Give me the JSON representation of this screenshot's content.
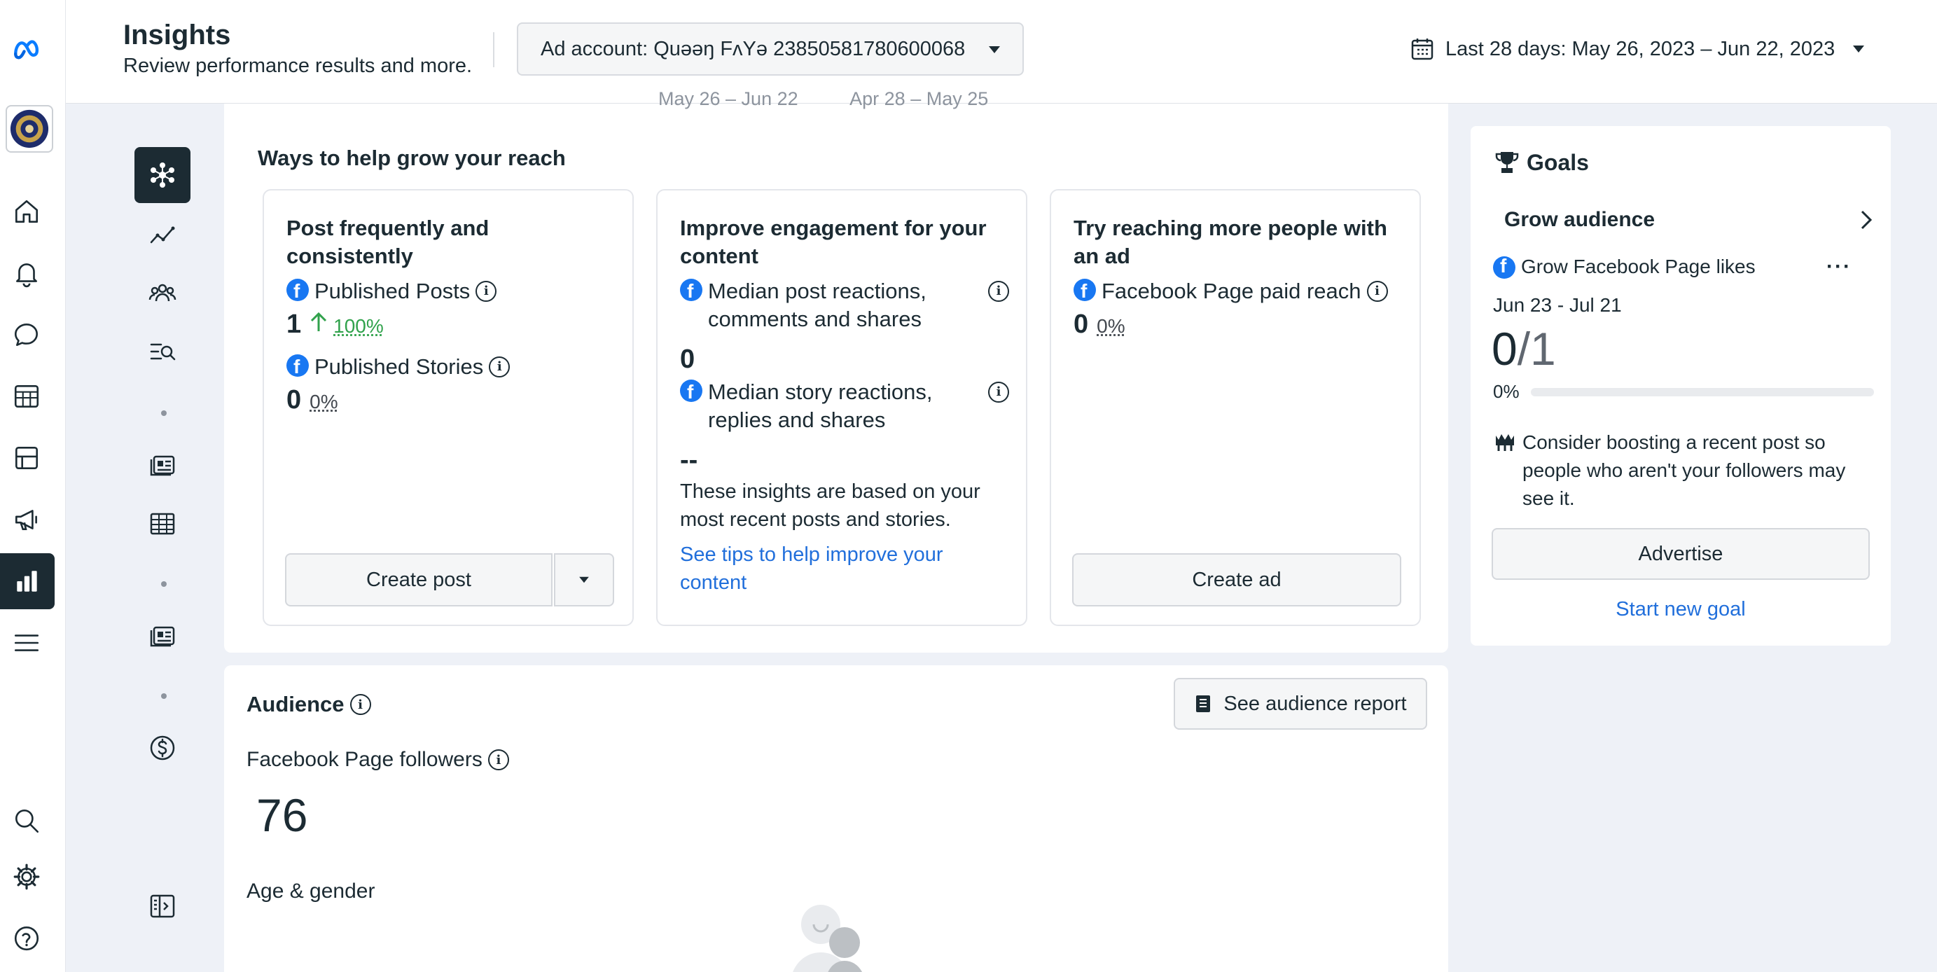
{
  "header": {
    "title": "Insights",
    "subtitle": "Review performance results and more.",
    "account_label": "Ad account: Quəəŋ FʌYə 238505817806000​68",
    "date_range": "Last 28 days: May 26, 2023 – Jun 22, 2023"
  },
  "rail": {
    "icons": [
      "meta-logo-icon",
      "page-avatar",
      "home-icon",
      "bell-icon",
      "chat-icon",
      "calendar-grid-icon",
      "content-icon",
      "megaphone-icon",
      "insights-icon",
      "menu-icon",
      "search-icon",
      "gear-icon",
      "help-icon"
    ],
    "active": "insights-icon"
  },
  "main": {
    "ghost_dates": "May 26 – Jun 22          Apr 28 – May 25",
    "grow_title": "Ways to help grow your reach",
    "cards": [
      {
        "title": "Post frequently and consistently",
        "metrics": [
          {
            "label": "Published Posts",
            "value": "1",
            "change": "100%",
            "trend": "up"
          },
          {
            "label": "Published Stories",
            "value": "0",
            "change": "0%"
          }
        ],
        "button": "Create post"
      },
      {
        "title": "Improve engagement for your content",
        "metrics": [
          {
            "label": "Median post reactions, comments and shares",
            "value": "0"
          },
          {
            "label": "Median story reactions, replies and shares",
            "value": "--"
          }
        ],
        "note": "These insights are based on your most recent posts and stories.",
        "link": "See tips to help improve your content"
      },
      {
        "title": "Try reaching more people with an ad",
        "metrics": [
          {
            "label": "Facebook Page paid reach",
            "value": "0",
            "change": "0%"
          }
        ],
        "button": "Create ad"
      }
    ]
  },
  "goals": {
    "title": "Goals",
    "section": "Grow audience",
    "goal_name": "Grow Facebook Page likes",
    "date_range": "Jun 23 - Jul 21",
    "progress_current": "0",
    "progress_target": "/1",
    "progress_pct": "0%",
    "progress_fraction": 0,
    "tip": "Consider boosting a recent post so people who aren't your followers may see it.",
    "advertise_button": "Advertise",
    "start_new_goal": "Start new goal"
  },
  "audience": {
    "title": "Audience",
    "report_button": "See audience report",
    "followers_label": "Facebook Page followers",
    "followers_value": "76",
    "age_gender_label": "Age & gender"
  },
  "colors": {
    "accent": "#1877f2",
    "link": "#216fdb",
    "active_nav": "#1c2b33",
    "positive": "#31a24c"
  }
}
